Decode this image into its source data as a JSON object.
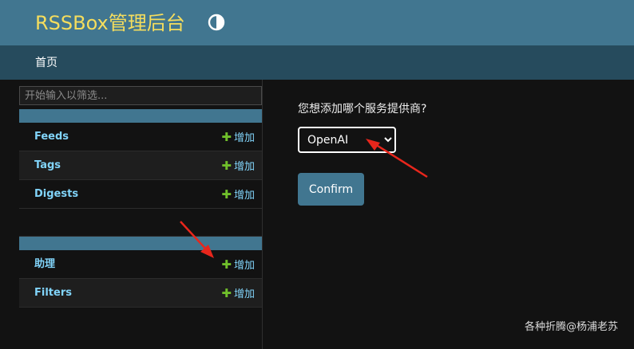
{
  "header": {
    "brand": "RSSBox管理后台",
    "theme_toggle_icon": "half-circle-contrast-icon"
  },
  "breadcrumbs": {
    "home": "首页"
  },
  "sidebar": {
    "filter_placeholder": "开始输入以筛选...",
    "modules": [
      {
        "rows": [
          {
            "label": "Feeds",
            "add_label": "增加"
          },
          {
            "label": "Tags",
            "add_label": "增加"
          },
          {
            "label": "Digests",
            "add_label": "增加"
          }
        ]
      },
      {
        "rows": [
          {
            "label": "助理",
            "add_label": "增加"
          },
          {
            "label": "Filters",
            "add_label": "增加"
          }
        ]
      }
    ]
  },
  "main": {
    "question": "您想添加哪个服务提供商?",
    "select_value": "OpenAI",
    "confirm_label": "Confirm"
  },
  "watermark": "各种折腾@杨浦老苏",
  "colors": {
    "header_bg": "#417690",
    "breadcrumb_bg": "#264b5d",
    "brand_text": "#f5dd5d",
    "link": "#81d4fa",
    "add_plus": "#70bf2b",
    "annotation_arrow": "#e8261c"
  }
}
